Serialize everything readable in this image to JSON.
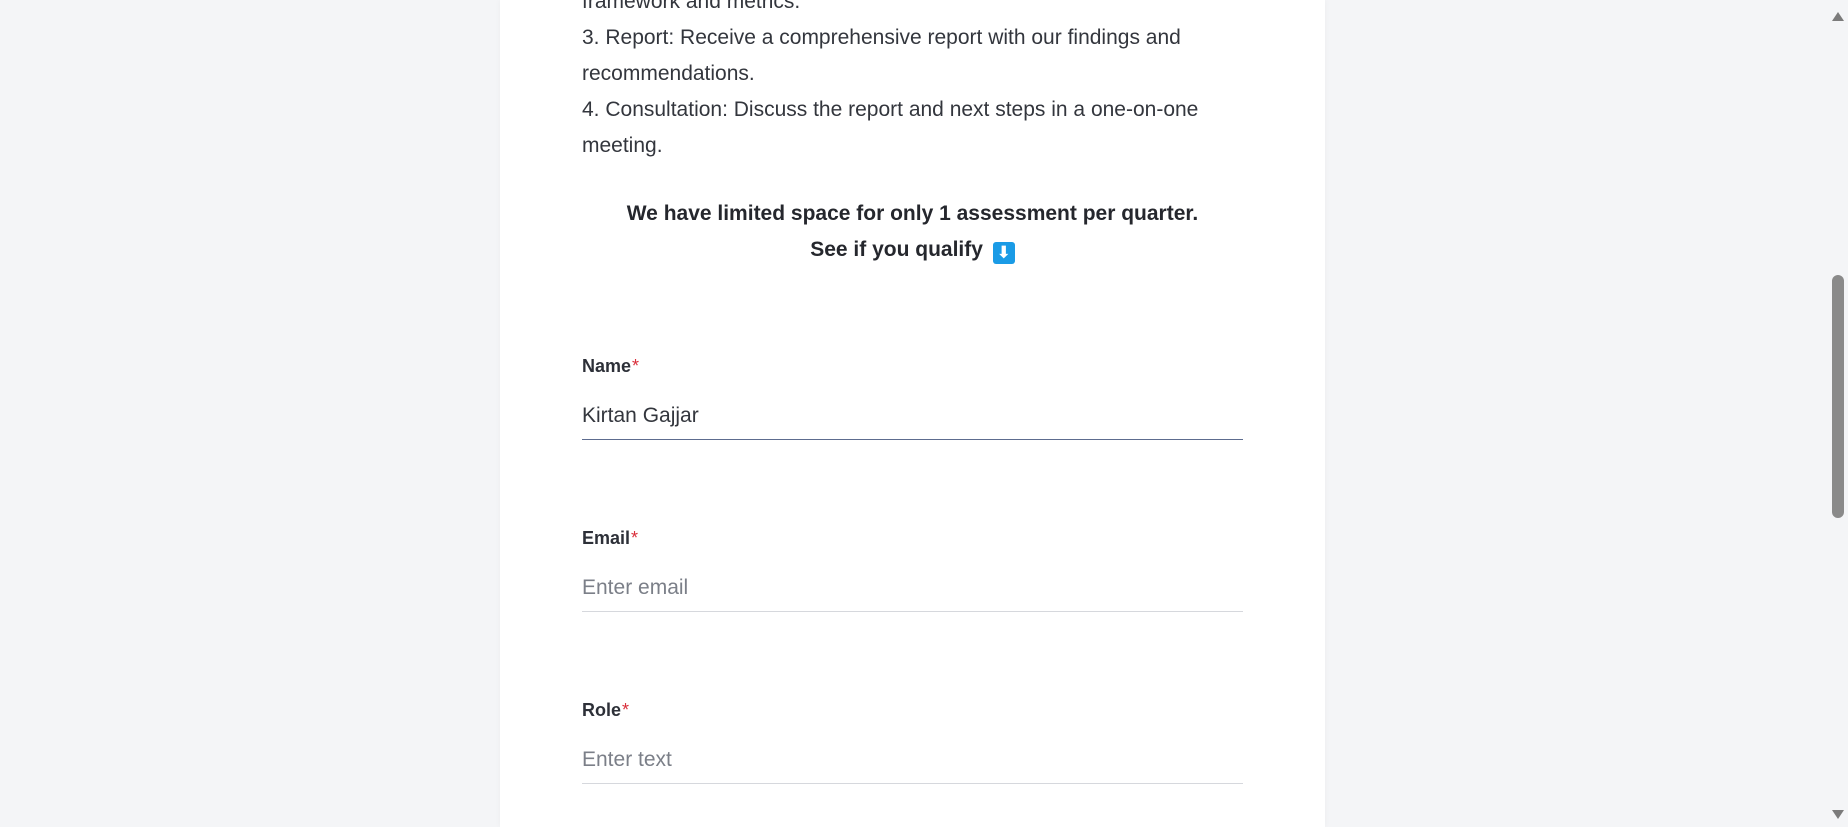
{
  "intro": {
    "partial_line": "framework and metrics.",
    "report_line_1": "3. Report: Receive a comprehensive report with our findings and",
    "report_line_2": "recommendations.",
    "consultation_line_1": "4. Consultation: Discuss the report and next steps in a one-on-one",
    "consultation_line_2": "meeting."
  },
  "callout": {
    "limited_space": "We have limited space for only 1 assessment per quarter.",
    "qualify": "See if you qualify",
    "arrow_icon": "down-arrow-emoji",
    "arrow_glyph": "⬇",
    "arrow_color": "#1a9be6"
  },
  "form": {
    "name": {
      "label": "Name",
      "required_mark": "*",
      "value": "Kirtan Gajjar"
    },
    "email": {
      "label": "Email",
      "required_mark": "*",
      "value": "",
      "placeholder": "Enter email"
    },
    "role": {
      "label": "Role",
      "required_mark": "*",
      "value": "",
      "placeholder": "Enter text"
    }
  },
  "colors": {
    "background": "#f4f5f7",
    "card": "#ffffff",
    "required": "#d92e3a",
    "focused_underline": "#5d6c8f"
  }
}
